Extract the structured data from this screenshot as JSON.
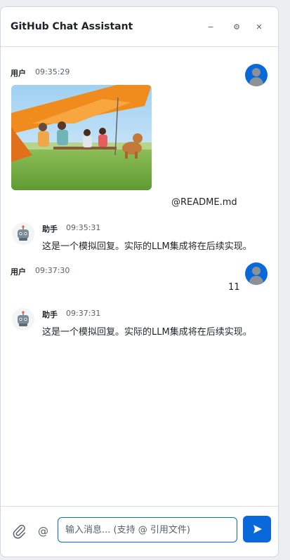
{
  "header": {
    "title": "GitHub Chat Assistant",
    "minimize_label": "−",
    "settings_label": "⚙",
    "close_label": "✕"
  },
  "messages": [
    {
      "role": "user",
      "sender": "用户",
      "time": "09:35:29",
      "has_image": true,
      "text": "@README.md"
    },
    {
      "role": "assistant",
      "sender": "助手",
      "time": "09:35:31",
      "text": "这是一个模拟回复。实际的LLM集成将在后续实现。"
    },
    {
      "role": "user",
      "sender": "用户",
      "time": "09:37:30",
      "text": "11"
    },
    {
      "role": "assistant",
      "sender": "助手",
      "time": "09:37:31",
      "text": "这是一个模拟回复。实际的LLM集成将在后续实现。"
    }
  ],
  "composer": {
    "at_label": "@",
    "placeholder": "输入消息... (支持 @ 引用文件)",
    "value": ""
  },
  "colors": {
    "accent": "#0969da",
    "border": "#d0d7de",
    "muted": "#57606a"
  },
  "icons": [
    "minimize-icon",
    "gear-icon",
    "close-icon",
    "user-avatar",
    "robot-icon",
    "paperclip-icon",
    "at-icon",
    "send-icon"
  ]
}
